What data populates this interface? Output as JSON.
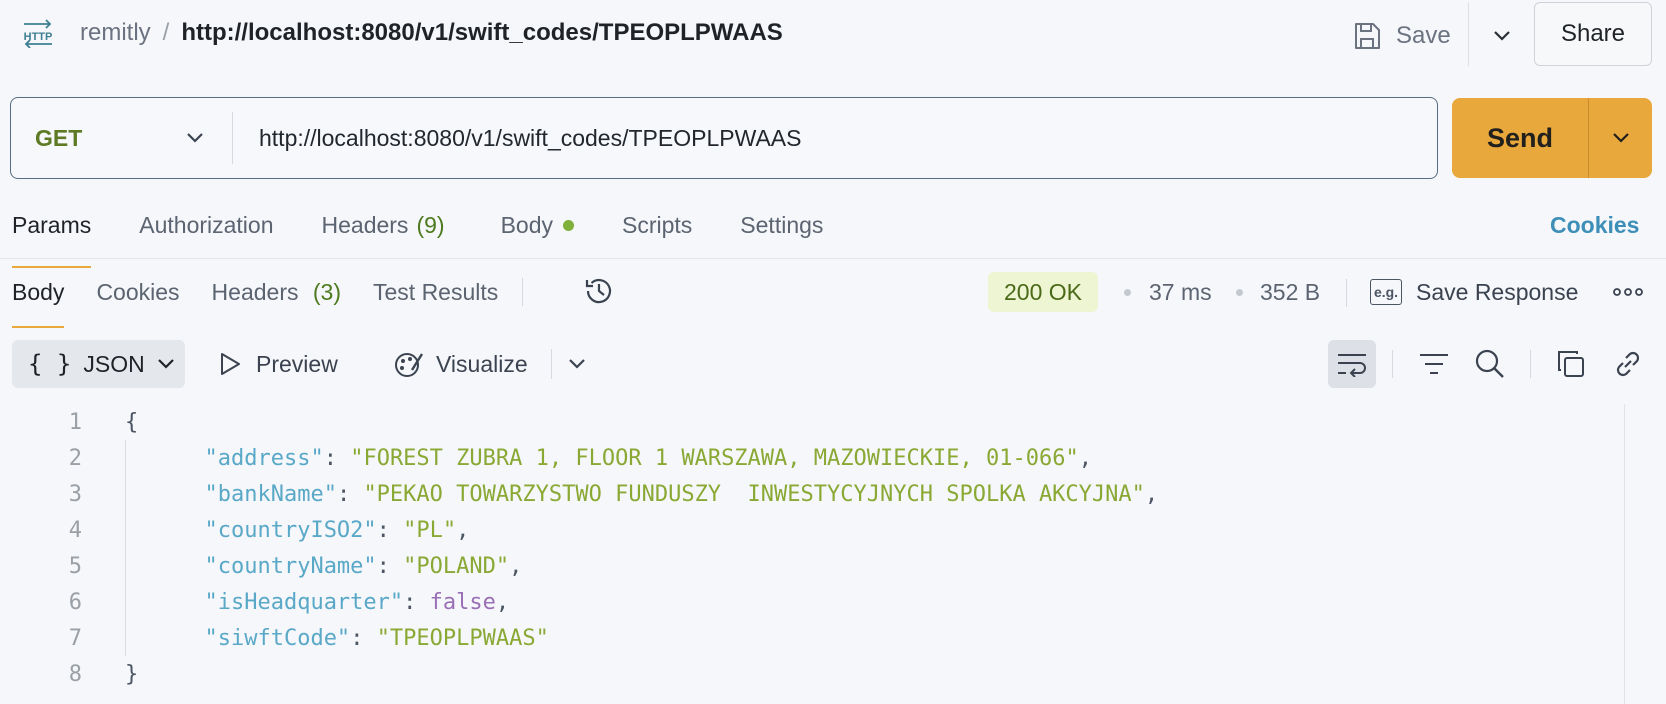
{
  "header": {
    "workspace": "remitly",
    "separator": "/",
    "title": "http://localhost:8080/v1/swift_codes/TPEOPLPWAAS",
    "save_label": "Save",
    "share_label": "Share"
  },
  "request": {
    "method": "GET",
    "url": "http://localhost:8080/v1/swift_codes/TPEOPLPWAAS",
    "send_label": "Send"
  },
  "request_tabs": {
    "params": "Params",
    "authorization": "Authorization",
    "headers": "Headers",
    "headers_count": "(9)",
    "body": "Body",
    "scripts": "Scripts",
    "settings": "Settings",
    "cookies": "Cookies"
  },
  "response_tabs": {
    "body": "Body",
    "cookies": "Cookies",
    "headers": "Headers",
    "headers_count": "(3)",
    "test_results": "Test Results"
  },
  "response_meta": {
    "status": "200 OK",
    "time": "37 ms",
    "size": "352 B",
    "eg_label": "e.g.",
    "save_response": "Save Response"
  },
  "response_toolbar": {
    "format_braces": "{ }",
    "format": "JSON",
    "preview": "Preview",
    "visualize": "Visualize"
  },
  "code": {
    "line_numbers": [
      "1",
      "2",
      "3",
      "4",
      "5",
      "6",
      "7",
      "8"
    ],
    "open_brace": "{",
    "close_brace": "}",
    "fields": [
      {
        "key": "\"address\"",
        "value": "\"FOREST ZUBRA 1, FLOOR 1 WARSZAWA, MAZOWIECKIE, 01-066\"",
        "kind": "string",
        "comma": ","
      },
      {
        "key": "\"bankName\"",
        "value": "\"PEKAO TOWARZYSTWO FUNDUSZY  INWESTYCYJNYCH SPOLKA AKCYJNA\"",
        "kind": "string",
        "comma": ","
      },
      {
        "key": "\"countryISO2\"",
        "value": "\"PL\"",
        "kind": "string",
        "comma": ","
      },
      {
        "key": "\"countryName\"",
        "value": "\"POLAND\"",
        "kind": "string",
        "comma": ","
      },
      {
        "key": "\"isHeadquarter\"",
        "value": "false",
        "kind": "boolean",
        "comma": ","
      },
      {
        "key": "\"siwftCode\"",
        "value": "\"TPEOPLPWAAS\"",
        "kind": "string",
        "comma": ""
      }
    ]
  },
  "colors": {
    "accent": "#e8a83c",
    "method_get": "#5e7a24",
    "status_ok_bg": "#eef5d2",
    "json_key": "#5aa8c8",
    "json_string": "#8aa834",
    "json_boolean": "#9a6fb5",
    "cookies_link": "#3e8fb8"
  },
  "icons": {
    "app": "http-icon",
    "save": "save-icon",
    "history": "history-icon",
    "preview": "play-icon",
    "visualize": "visualize-icon",
    "wrap": "wrap-lines-icon",
    "filter": "filter-icon",
    "search": "search-icon",
    "copy": "copy-icon",
    "link": "link-icon",
    "more": "more-icon"
  }
}
